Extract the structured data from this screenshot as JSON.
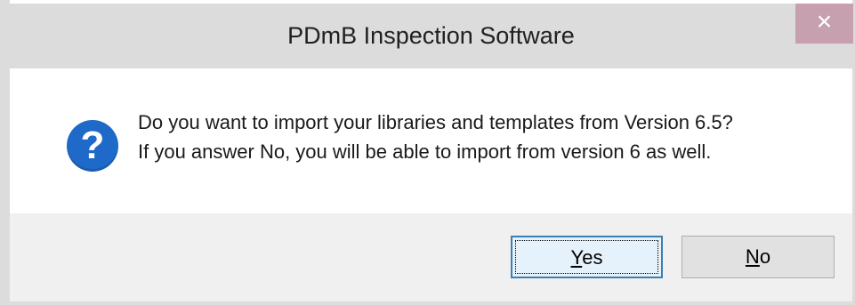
{
  "window": {
    "title": "PDmB Inspection Software",
    "close_icon": "×"
  },
  "dialog": {
    "icon": "question-icon",
    "icon_glyph": "?",
    "message_line1": "Do you want to import your libraries and templates from Version 6.5?",
    "message_line2": "If you answer No, you will be able to import from version 6 as well."
  },
  "buttons": {
    "yes_accel": "Y",
    "yes_rest": "es",
    "no_accel": "N",
    "no_rest": "o"
  },
  "colors": {
    "title_bar": "#dcdcdc",
    "close_button": "#c7a0b0",
    "icon_blue": "#1f69c8",
    "footer": "#f0f0f0",
    "default_button_border": "#3c7fb1"
  }
}
